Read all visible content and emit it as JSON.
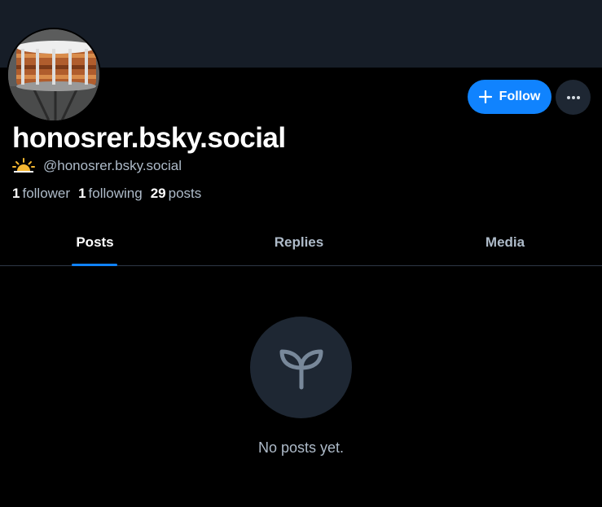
{
  "profile": {
    "display_name": "honosrer.bsky.social",
    "handle": "@honosrer.bsky.social",
    "badge_icon": "sunrise-icon",
    "followers_count": "1",
    "followers_label": "follower",
    "following_count": "1",
    "following_label": "following",
    "posts_count": "29",
    "posts_label": "posts"
  },
  "actions": {
    "follow_label": "Follow",
    "follow_icon": "plus-icon",
    "more_icon": "ellipsis-icon"
  },
  "tabs": [
    {
      "label": "Posts",
      "active": true
    },
    {
      "label": "Replies",
      "active": false
    },
    {
      "label": "Media",
      "active": false
    }
  ],
  "empty_state": {
    "icon": "seedling-icon",
    "message": "No posts yet."
  },
  "colors": {
    "background": "#000000",
    "banner": "#161d27",
    "accent": "#1083fe",
    "muted_text": "#aebbc9",
    "surface": "#1e2733"
  }
}
